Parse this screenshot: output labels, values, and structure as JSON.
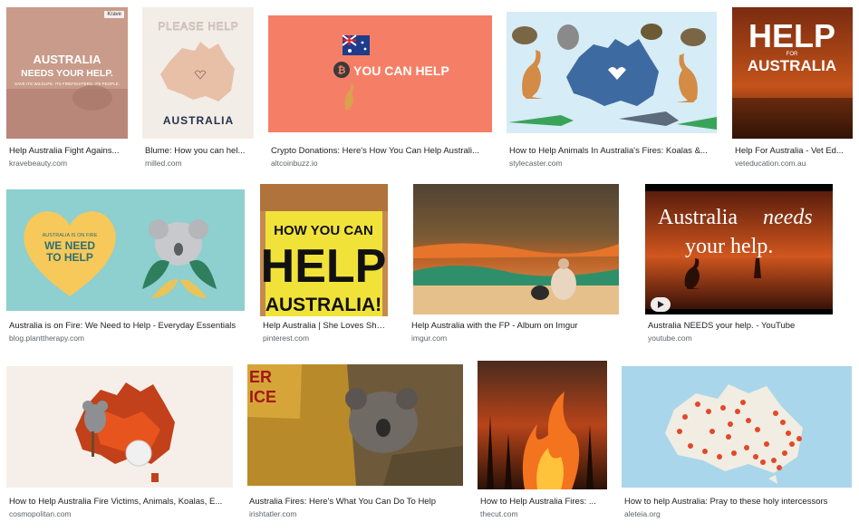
{
  "results": [
    {
      "caption": "Help Australia Fight Agains...",
      "source": "kravebeauty.com",
      "overlay": [
        "AUSTRALIA",
        "NEEDS YOUR HELP."
      ],
      "small_text": "SAVE ITS WILDLIFE. ITS FIREFIGHTERS. ITS PEOPLE.",
      "tag": "Krave"
    },
    {
      "caption": "Blume: How you can hel...",
      "source": "milled.com",
      "overlay": [
        "PLEASE HELP",
        "AUSTRALIA"
      ]
    },
    {
      "caption": "Crypto Donations: Here's How You Can Help Australi...",
      "source": "altcoinbuzz.io",
      "overlay": [
        "YOU CAN HELP"
      ]
    },
    {
      "caption": "How to Help Animals In Australia's Fires: Koalas &...",
      "source": "stylecaster.com"
    },
    {
      "caption": "Help For Australia - Vet Ed...",
      "source": "veteducation.com.au",
      "overlay": [
        "HELP",
        "FOR",
        "AUSTRALIA"
      ]
    },
    {
      "caption": "Australia is on Fire: We Need to Help - Everyday Essentials",
      "source": "blog.planttherapy.com",
      "overlay": [
        "AUSTRALIA IS ON FIRE",
        "WE NEED",
        "TO HELP"
      ]
    },
    {
      "caption": "Help Australia | She Loves She...",
      "source": "pinterest.com",
      "overlay": [
        "HOW YOU CAN",
        "HELP",
        "AUSTRALIA!"
      ]
    },
    {
      "caption": "Help Australia with the FP - Album on Imgur",
      "source": "imgur.com"
    },
    {
      "caption": "Australia NEEDS your help. - YouTube",
      "source": "youtube.com",
      "overlay": [
        "Australia",
        "needs",
        "your help."
      ]
    },
    {
      "caption": "How to Help Australia Fire Victims, Animals, Koalas, E...",
      "source": "cosmopolitan.com"
    },
    {
      "caption": "Australia Fires: Here's What You Can Do To Help",
      "source": "irishtatler.com",
      "overlay": [
        "ER",
        "ICE"
      ]
    },
    {
      "caption": "How to Help Australia Fires: ...",
      "source": "thecut.com"
    },
    {
      "caption": "How to help Australia: Pray to these holy intercessors",
      "source": "aleteia.org"
    }
  ],
  "colors": {
    "caption": "#202124",
    "source": "#5f6368",
    "fire_orange": "#e8541e",
    "ocean_teal": "#8ecfcf",
    "sky_blue": "#d6ecf6"
  }
}
